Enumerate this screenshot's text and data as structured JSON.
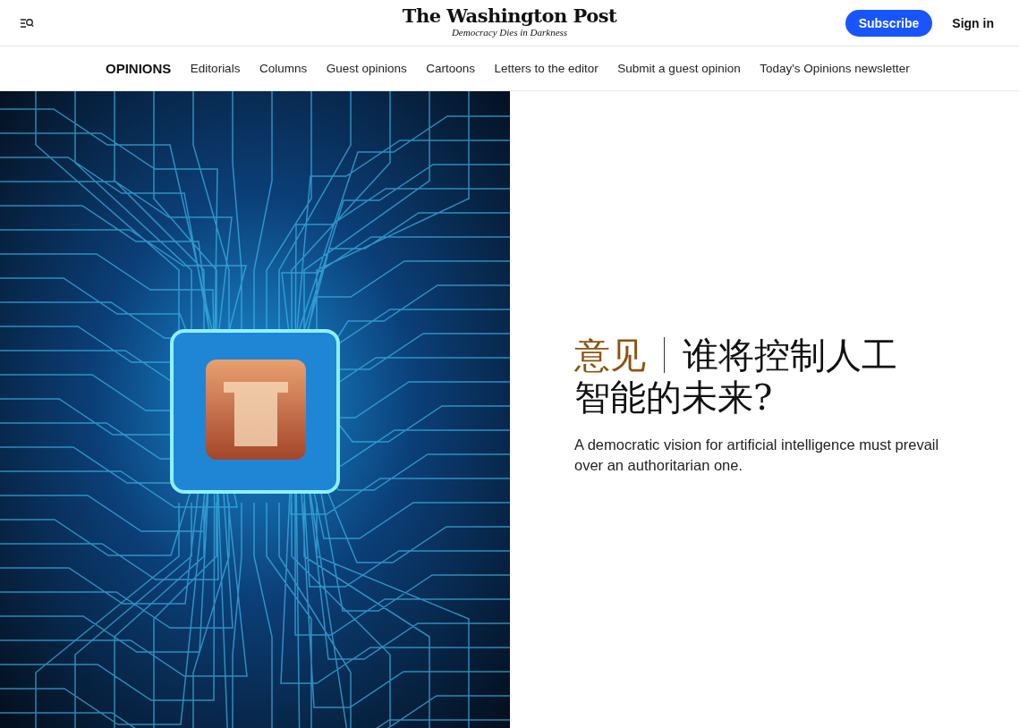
{
  "header": {
    "logo": "The Washington Post",
    "tagline": "Democracy Dies in Darkness",
    "subscribe": "Subscribe",
    "sign_in": "Sign in"
  },
  "nav": {
    "section": "OPINIONS",
    "links": [
      "Editorials",
      "Columns",
      "Guest opinions",
      "Cartoons",
      "Letters to the editor",
      "Submit a guest opinion",
      "Today's Opinions newsletter"
    ]
  },
  "article": {
    "kicker": "意见",
    "headline_lines": [
      "谁将控制人工",
      "智能的未来?"
    ],
    "dek": "A democratic vision for artificial intelligence must prevail over an authoritarian one."
  }
}
